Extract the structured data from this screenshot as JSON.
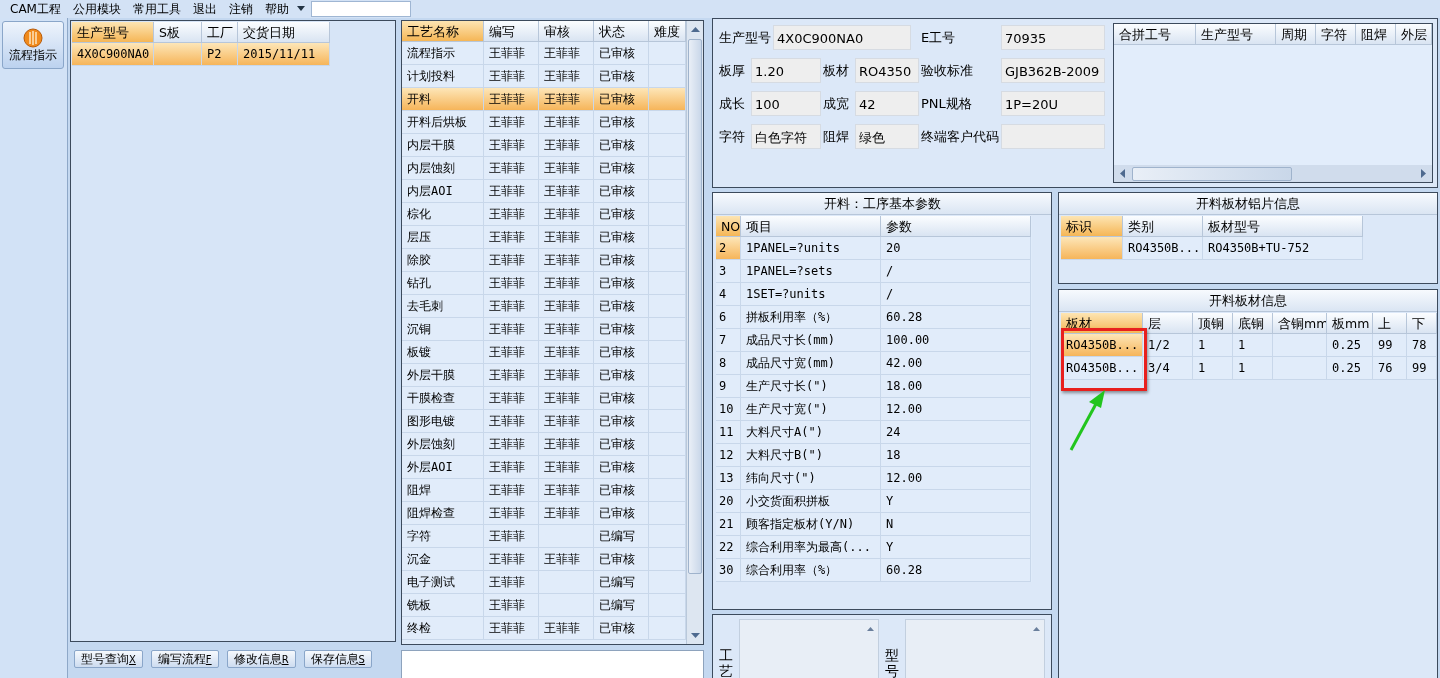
{
  "menu": [
    {
      "label": "CAM工程"
    },
    {
      "label": "公用模块"
    },
    {
      "label": "常用工具"
    },
    {
      "label": "退出"
    },
    {
      "label": "注销"
    },
    {
      "label": "帮助"
    }
  ],
  "nav": [
    {
      "label": "流程指示",
      "selected": true
    }
  ],
  "orders": {
    "columns": [
      {
        "label": "生产型号",
        "selected": true
      },
      {
        "label": "S板",
        "selected": false
      },
      {
        "label": "工厂",
        "selected": false
      },
      {
        "label": "交货日期",
        "selected": false
      }
    ],
    "rows": [
      {
        "cells": [
          "4X0C900NA0",
          null,
          "P2",
          "2015/11/11"
        ],
        "selected": true
      }
    ]
  },
  "process": {
    "columns": [
      {
        "label": "工艺名称",
        "selected": true
      },
      {
        "label": "编写",
        "selected": false
      },
      {
        "label": "审核",
        "selected": false
      },
      {
        "label": "状态",
        "selected": false
      },
      {
        "label": "难度",
        "selected": false
      }
    ],
    "rows": [
      {
        "name": "流程指示",
        "writer": "王菲菲",
        "reviewer": "王菲菲",
        "status": "已审核",
        "selected": false
      },
      {
        "name": "计划投料",
        "writer": "王菲菲",
        "reviewer": "王菲菲",
        "status": "已审核",
        "selected": false
      },
      {
        "name": "开料",
        "writer": "王菲菲",
        "reviewer": "王菲菲",
        "status": "已审核",
        "selected": true
      },
      {
        "name": "开料后烘板",
        "writer": "王菲菲",
        "reviewer": "王菲菲",
        "status": "已审核",
        "selected": false
      },
      {
        "name": "内层干膜",
        "writer": "王菲菲",
        "reviewer": "王菲菲",
        "status": "已审核",
        "selected": false
      },
      {
        "name": "内层蚀刻",
        "writer": "王菲菲",
        "reviewer": "王菲菲",
        "status": "已审核",
        "selected": false
      },
      {
        "name": "内层AOI",
        "writer": "王菲菲",
        "reviewer": "王菲菲",
        "status": "已审核",
        "selected": false
      },
      {
        "name": "棕化",
        "writer": "王菲菲",
        "reviewer": "王菲菲",
        "status": "已审核",
        "selected": false
      },
      {
        "name": "层压",
        "writer": "王菲菲",
        "reviewer": "王菲菲",
        "status": "已审核",
        "selected": false
      },
      {
        "name": "除胶",
        "writer": "王菲菲",
        "reviewer": "王菲菲",
        "status": "已审核",
        "selected": false
      },
      {
        "name": "钻孔",
        "writer": "王菲菲",
        "reviewer": "王菲菲",
        "status": "已审核",
        "selected": false
      },
      {
        "name": "去毛刺",
        "writer": "王菲菲",
        "reviewer": "王菲菲",
        "status": "已审核",
        "selected": false
      },
      {
        "name": "沉铜",
        "writer": "王菲菲",
        "reviewer": "王菲菲",
        "status": "已审核",
        "selected": false
      },
      {
        "name": "板镀",
        "writer": "王菲菲",
        "reviewer": "王菲菲",
        "status": "已审核",
        "selected": false
      },
      {
        "name": "外层干膜",
        "writer": "王菲菲",
        "reviewer": "王菲菲",
        "status": "已审核",
        "selected": false
      },
      {
        "name": "干膜检查",
        "writer": "王菲菲",
        "reviewer": "王菲菲",
        "status": "已审核",
        "selected": false
      },
      {
        "name": "图形电镀",
        "writer": "王菲菲",
        "reviewer": "王菲菲",
        "status": "已审核",
        "selected": false
      },
      {
        "name": "外层蚀刻",
        "writer": "王菲菲",
        "reviewer": "王菲菲",
        "status": "已审核",
        "selected": false
      },
      {
        "name": "外层AOI",
        "writer": "王菲菲",
        "reviewer": "王菲菲",
        "status": "已审核",
        "selected": false
      },
      {
        "name": "阻焊",
        "writer": "王菲菲",
        "reviewer": "王菲菲",
        "status": "已审核",
        "selected": false
      },
      {
        "name": "阻焊检查",
        "writer": "王菲菲",
        "reviewer": "王菲菲",
        "status": "已审核",
        "selected": false
      },
      {
        "name": "字符",
        "writer": "王菲菲",
        "status": "已编写",
        "selected": false
      },
      {
        "name": "沉金",
        "writer": "王菲菲",
        "reviewer": "王菲菲",
        "status": "已审核",
        "selected": false
      },
      {
        "name": "电子测试",
        "writer": "王菲菲",
        "status": "已编写",
        "selected": false
      },
      {
        "name": "铣板",
        "writer": "王菲菲",
        "status": "已编写",
        "selected": false
      },
      {
        "name": "终检",
        "writer": "王菲菲",
        "reviewer": "王菲菲",
        "status": "已审核",
        "selected": false
      }
    ]
  },
  "buttons": [
    {
      "label": "型号查询",
      "key": "X"
    },
    {
      "label": "编写流程",
      "key": "F"
    },
    {
      "label": "修改信息",
      "key": "R"
    },
    {
      "label": "保存信息",
      "key": "S"
    }
  ],
  "info": {
    "header": [
      {
        "label": "生产型号",
        "value": "4X0C900NA0"
      },
      {
        "label": "E工号",
        "value": "70935"
      }
    ],
    "rows": [
      [
        {
          "label": "板厚",
          "value": "1.20"
        },
        {
          "label": "板材",
          "value": "RO4350"
        },
        {
          "label": "验收标准",
          "value": "GJB362B-2009"
        }
      ],
      [
        {
          "label": "成长",
          "value": "100"
        },
        {
          "label": "成宽",
          "value": "42"
        },
        {
          "label": "PNL规格",
          "value": "1P=20U"
        }
      ],
      [
        {
          "label": "字符",
          "value": "白色字符"
        },
        {
          "label": "阻焊",
          "value": "绿色"
        },
        {
          "label": "终端客户代码"
        }
      ]
    ]
  },
  "merge_grid": {
    "columns": [
      "合拼工号",
      "生产型号",
      "周期",
      "字符",
      "阻焊",
      "外层"
    ]
  },
  "params": {
    "title": "开料：工序基本参数",
    "columns": [
      {
        "label": "NO",
        "selected": true
      },
      {
        "label": "项目",
        "selected": false
      },
      {
        "label": "参数",
        "selected": false
      }
    ],
    "rows": [
      {
        "no": "2",
        "item": "1PANEL=?units",
        "value": "20",
        "selected": true
      },
      {
        "no": "3",
        "item": "1PANEL=?sets",
        "value": "/",
        "selected": false
      },
      {
        "no": "4",
        "item": "1SET=?units",
        "value": "/",
        "selected": false
      },
      {
        "no": "6",
        "item": "拼板利用率（%）",
        "value": "60.28",
        "selected": false
      },
      {
        "no": "7",
        "item": "成品尺寸长(mm)",
        "value": "100.00",
        "selected": false
      },
      {
        "no": "8",
        "item": "成品尺寸宽(mm)",
        "value": "42.00",
        "selected": false
      },
      {
        "no": "9",
        "item": "生产尺寸长(\")",
        "value": "18.00",
        "selected": false
      },
      {
        "no": "10",
        "item": "生产尺寸宽(\")",
        "value": "12.00",
        "selected": false
      },
      {
        "no": "11",
        "item": "大料尺寸A(\")",
        "value": "24",
        "selected": false
      },
      {
        "no": "12",
        "item": "大料尺寸B(\")",
        "value": "18",
        "selected": false
      },
      {
        "no": "13",
        "item": "纬向尺寸(\")",
        "value": "12.00",
        "selected": false
      },
      {
        "no": "20",
        "item": "小交货面积拼板",
        "value": "Y",
        "selected": false
      },
      {
        "no": "21",
        "item": "顾客指定板材(Y/N)",
        "value": "N",
        "selected": false
      },
      {
        "no": "22",
        "item": "综合利用率为最高(...",
        "value": "Y",
        "selected": false
      },
      {
        "no": "30",
        "item": "综合利用率（%）",
        "value": "60.28",
        "selected": false
      }
    ]
  },
  "notes": [
    {
      "label": "工艺"
    },
    {
      "label": "型号"
    }
  ],
  "foil": {
    "title": "开料板材铝片信息",
    "columns": [
      {
        "label": "标识",
        "selected": true
      },
      {
        "label": "类别",
        "selected": false
      },
      {
        "label": "板材型号",
        "selected": false
      }
    ],
    "rows": [
      {
        "cells": [
          null,
          "RO4350B...",
          "RO4350B+TU-752"
        ],
        "selected": true
      }
    ]
  },
  "sheet": {
    "title": "开料板材信息",
    "columns": [
      {
        "label": "板材",
        "selected": true
      },
      {
        "label": "层",
        "selected": false
      },
      {
        "label": "顶铜",
        "selected": false
      },
      {
        "label": "底铜",
        "selected": false
      },
      {
        "label": "含铜mm",
        "selected": false
      },
      {
        "label": "板mm",
        "selected": false
      },
      {
        "label": "上",
        "selected": false
      },
      {
        "label": "下",
        "selected": false
      }
    ],
    "rows": [
      {
        "cells": [
          "RO4350B...",
          "1/2",
          "1",
          "1",
          null,
          "0.25",
          "99",
          "78"
        ],
        "selected": true
      },
      {
        "cells": [
          "RO4350B...",
          "3/4",
          "1",
          "1",
          null,
          "0.25",
          "76",
          "99"
        ],
        "selected": false
      }
    ]
  },
  "annotations": [
    {
      "kind": "frame",
      "color": "#e8201e"
    },
    {
      "kind": "arrow",
      "color": "#22c51e"
    }
  ]
}
